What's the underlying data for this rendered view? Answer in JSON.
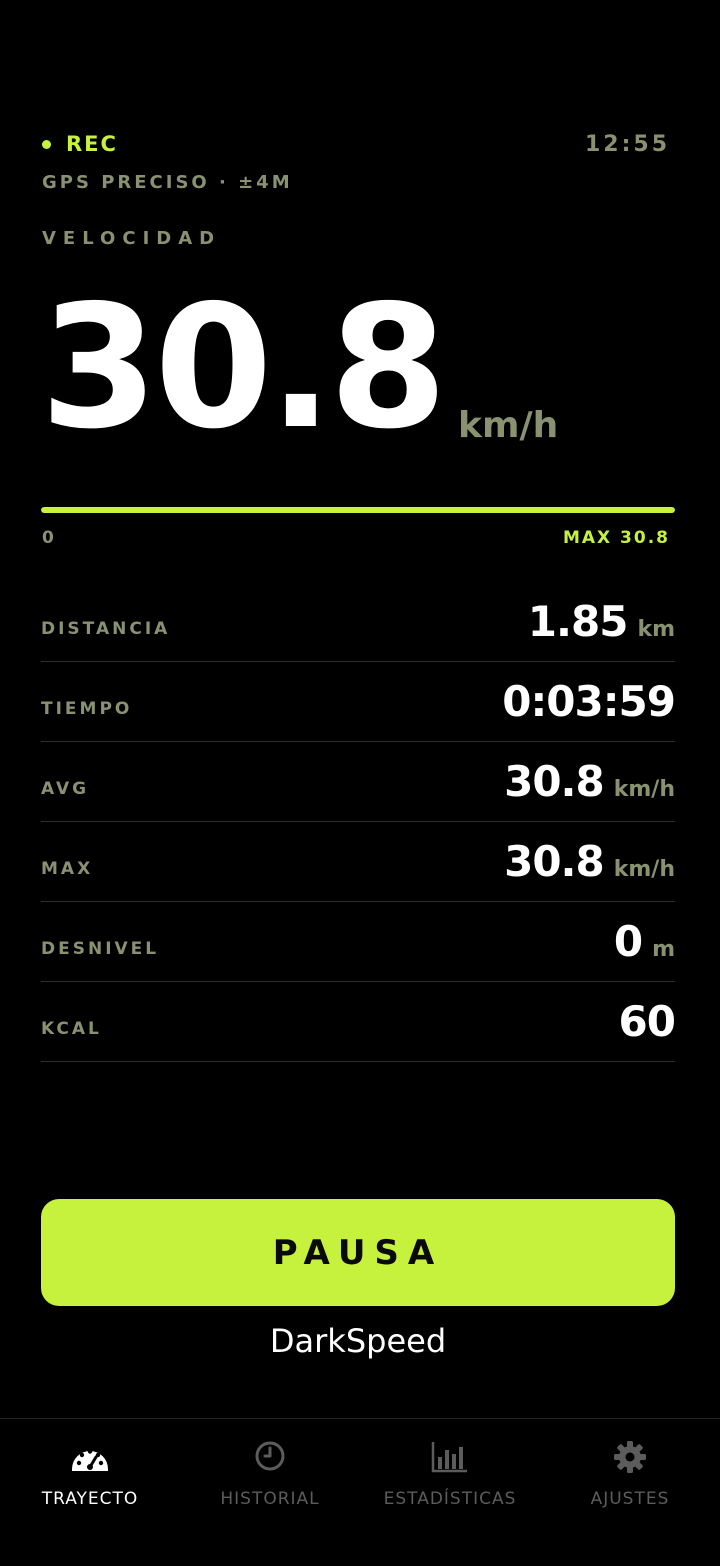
{
  "status": {
    "rec_label": "REC",
    "clock": "12:55",
    "gps": "GPS PRECISO · ±4M"
  },
  "speed": {
    "label": "VELOCIDAD",
    "value": "30.8",
    "unit": "km/h",
    "bar_fraction": 1.0,
    "bar_min": "0",
    "bar_max": "MAX 30.8"
  },
  "stats": [
    {
      "label": "DISTANCIA",
      "value": "1.85",
      "unit": "km"
    },
    {
      "label": "TIEMPO",
      "value": "0:03:59",
      "unit": ""
    },
    {
      "label": "AVG",
      "value": "30.8",
      "unit": "km/h"
    },
    {
      "label": "MAX",
      "value": "30.8",
      "unit": "km/h"
    },
    {
      "label": "DESNIVEL",
      "value": "0",
      "unit": "m"
    },
    {
      "label": "KCAL",
      "value": "60",
      "unit": ""
    }
  ],
  "pause_label": "PAUSA",
  "brand": "DarkSpeed",
  "tabs": [
    {
      "label": "TRAYECTO",
      "icon": "speedometer-icon",
      "active": true
    },
    {
      "label": "HISTORIAL",
      "icon": "clock-icon",
      "active": false
    },
    {
      "label": "ESTADÍSTICAS",
      "icon": "bar-chart-icon",
      "active": false
    },
    {
      "label": "AJUSTES",
      "icon": "gear-icon",
      "active": false
    }
  ],
  "colors": {
    "accent": "#c6f23e",
    "muted": "#8a9170",
    "background": "#000000"
  }
}
